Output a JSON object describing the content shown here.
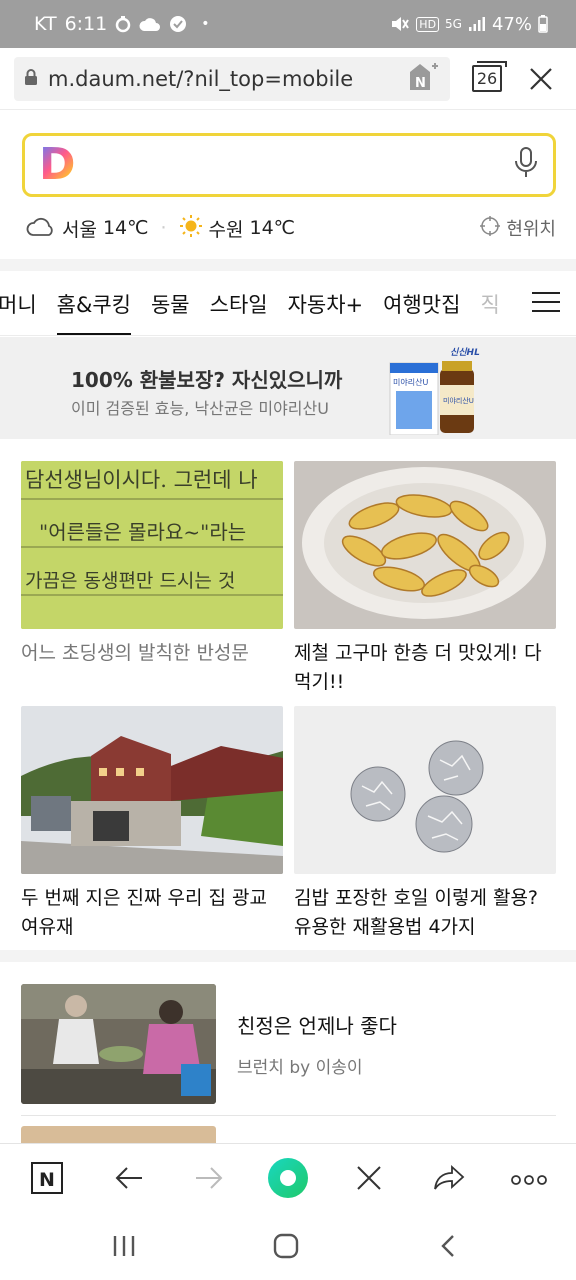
{
  "status_bar": {
    "carrier": "KT",
    "time": "6:11",
    "network": "5G",
    "hd": "HD",
    "battery": "47%"
  },
  "url_bar": {
    "url": "m.daum.net/?nil_top=mobile",
    "tab_count": "26"
  },
  "search": {
    "logo": "D",
    "placeholder": ""
  },
  "weather": [
    {
      "city": "서울",
      "temp": "14℃",
      "icon": "cloud-icon"
    },
    {
      "city": "수원",
      "temp": "14℃",
      "icon": "sun-icon"
    }
  ],
  "location_label": "현위치",
  "category_tabs": [
    {
      "label": "머니",
      "active": false
    },
    {
      "label": "홈&쿠킹",
      "active": true
    },
    {
      "label": "동물",
      "active": false
    },
    {
      "label": "스타일",
      "active": false
    },
    {
      "label": "자동차+",
      "active": false
    },
    {
      "label": "여행맛집",
      "active": false
    },
    {
      "label": "직",
      "active": false
    }
  ],
  "ad": {
    "title": "100% 환불보장? 자신있으니까",
    "subtitle": "이미 검증된 효능, 낙산균은 미야리산U",
    "product": "미야리산U",
    "brand": "신신HL"
  },
  "cards": [
    {
      "caption": "어느 초딩생의 발칙한 반성문",
      "muted": true
    },
    {
      "caption": "제철 고구마 한층 더 맛있게! 다 먹기!!",
      "muted": false
    },
    {
      "caption": "두 번째 지은 진짜 우리 집 광교 여유재",
      "muted": false
    },
    {
      "caption": "김밥 포장한 호일 이렇게 활용? 유용한 재활용법 4가지",
      "muted": false
    }
  ],
  "card1_handwriting": [
    "담선생님이시다.  그런데 나",
    "\"어른들은  몰라요~\"라는",
    "가끔은  동생편만  드시는 것"
  ],
  "list_items": [
    {
      "title": "친정은 언제나 좋다",
      "source": "브런치 by 이송이"
    }
  ],
  "colors": {
    "status_bar": "#9e9e9e",
    "search_border": "#f0d43a",
    "ad_bg": "#f0f0f0",
    "toolbar_accent": "#19c9a8"
  }
}
